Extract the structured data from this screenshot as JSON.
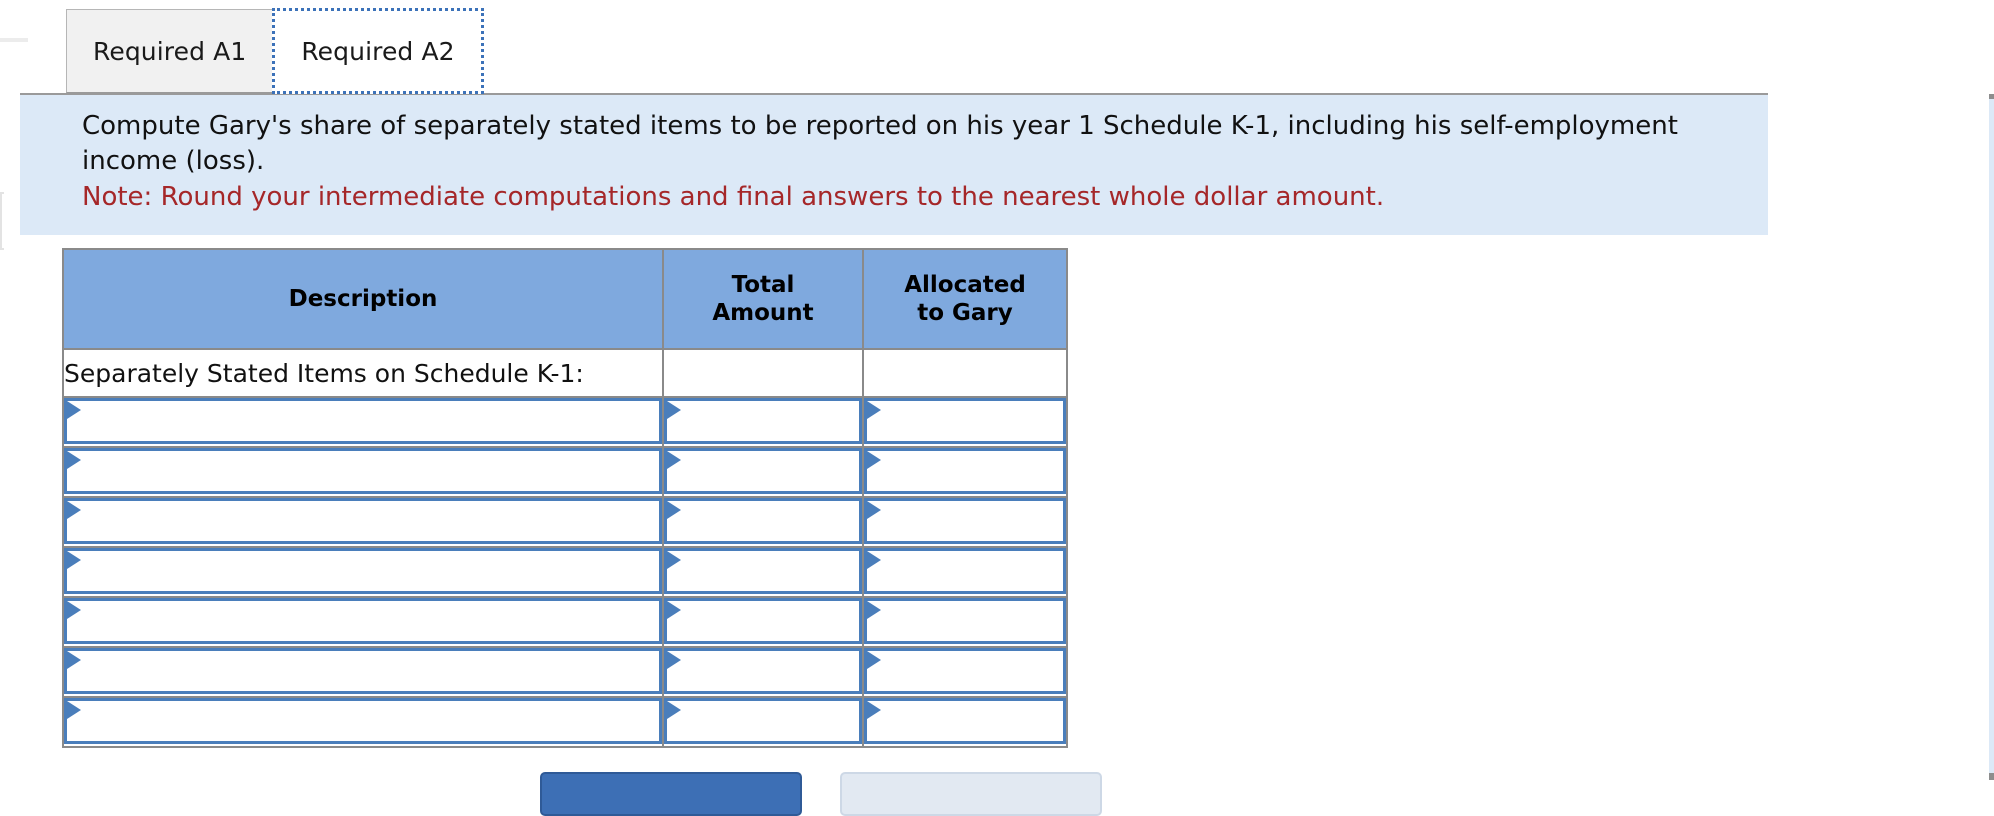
{
  "tabs": [
    {
      "label": "Required A1",
      "active": false
    },
    {
      "label": "Required A2",
      "active": true
    }
  ],
  "instruction": {
    "prompt": "Compute Gary's share of separately stated items to be reported on his year 1 Schedule K-1, including his self-employment income (loss).",
    "note": "Note: Round your intermediate computations and final answers to the nearest whole dollar amount.",
    "note_color": "#a52729",
    "panel_background": "#dce9f7"
  },
  "worksheet": {
    "header_color": "#7fa9de",
    "input_border_color": "#4a7ebb",
    "columns": [
      {
        "label": "Description"
      },
      {
        "label": "Total\nAmount",
        "line1": "Total",
        "line2": "Amount"
      },
      {
        "label": "Allocated\nto Gary",
        "line1": "Allocated",
        "line2": "to Gary"
      }
    ],
    "label_row": {
      "description": "Separately Stated Items on Schedule K-1:",
      "total_amount": "",
      "allocated_to_gary": ""
    },
    "input_rows": [
      {
        "description": "",
        "total_amount": "",
        "allocated_to_gary": ""
      },
      {
        "description": "",
        "total_amount": "",
        "allocated_to_gary": ""
      },
      {
        "description": "",
        "total_amount": "",
        "allocated_to_gary": ""
      },
      {
        "description": "",
        "total_amount": "",
        "allocated_to_gary": ""
      },
      {
        "description": "",
        "total_amount": "",
        "allocated_to_gary": ""
      },
      {
        "description": "",
        "total_amount": "",
        "allocated_to_gary": ""
      },
      {
        "description": "",
        "total_amount": "",
        "allocated_to_gary": ""
      }
    ]
  },
  "footer_buttons": [
    {
      "label": "",
      "style": "primary"
    },
    {
      "label": "",
      "style": "secondary"
    }
  ]
}
